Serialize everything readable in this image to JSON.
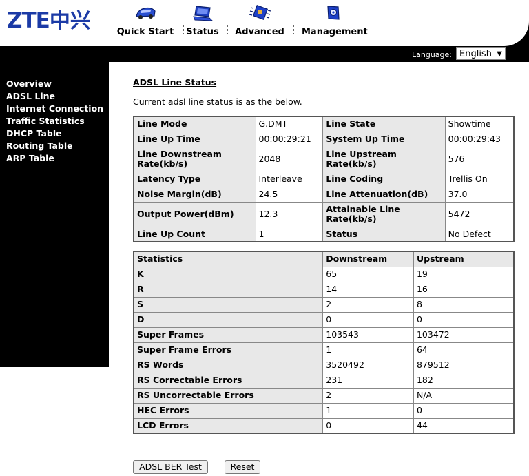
{
  "brand": {
    "logo_latin": "ZTE",
    "logo_cn": "中兴",
    "color": "#1b3aa6"
  },
  "nav": [
    {
      "label": "Quick Start",
      "icon": "car-icon"
    },
    {
      "label": "Status",
      "icon": "laptop-icon"
    },
    {
      "label": "Advanced",
      "icon": "chip-icon"
    },
    {
      "label": "Management",
      "icon": "device-icon"
    }
  ],
  "language": {
    "label": "Language:",
    "selected": "English"
  },
  "sidebar": {
    "items": [
      {
        "label": "Overview"
      },
      {
        "label": "ADSL Line"
      },
      {
        "label": "Internet Connection"
      },
      {
        "label": "Traffic Statistics"
      },
      {
        "label": "DHCP Table"
      },
      {
        "label": "Routing Table"
      },
      {
        "label": "ARP Table"
      }
    ]
  },
  "page": {
    "title": "ADSL Line Status",
    "description": "Current adsl line status is as the below."
  },
  "line_status": {
    "rows": [
      [
        "Line Mode",
        "G.DMT",
        "Line State",
        "Showtime"
      ],
      [
        "Line Up Time",
        "00:00:29:21",
        "System Up Time",
        "00:00:29:43"
      ],
      [
        "Line Downstream Rate(kb/s)",
        "2048",
        "Line Upstream Rate(kb/s)",
        "576"
      ],
      [
        "Latency Type",
        "Interleave",
        "Line Coding",
        "Trellis On"
      ],
      [
        "Noise Margin(dB)",
        "24.5",
        "Line Attenuation(dB)",
        "37.0"
      ],
      [
        "Output Power(dBm)",
        "12.3",
        "Attainable Line Rate(kb/s)",
        "5472"
      ],
      [
        "Line Up Count",
        "1",
        "Status",
        "No Defect"
      ]
    ]
  },
  "statistics": {
    "headers": [
      "Statistics",
      "Downstream",
      "Upstream"
    ],
    "rows": [
      [
        "K",
        "65",
        "19"
      ],
      [
        "R",
        "14",
        "16"
      ],
      [
        "S",
        "2",
        "8"
      ],
      [
        "D",
        "0",
        "0"
      ],
      [
        "Super Frames",
        "103543",
        "103472"
      ],
      [
        "Super Frame Errors",
        "1",
        "64"
      ],
      [
        "RS Words",
        "3520492",
        "879512"
      ],
      [
        "RS Correctable Errors",
        "231",
        "182"
      ],
      [
        "RS Uncorrectable Errors",
        "2",
        "N/A"
      ],
      [
        "HEC Errors",
        "1",
        "0"
      ],
      [
        "LCD Errors",
        "0",
        "44"
      ]
    ]
  },
  "buttons": {
    "ber_test": "ADSL BER Test",
    "reset": "Reset"
  }
}
